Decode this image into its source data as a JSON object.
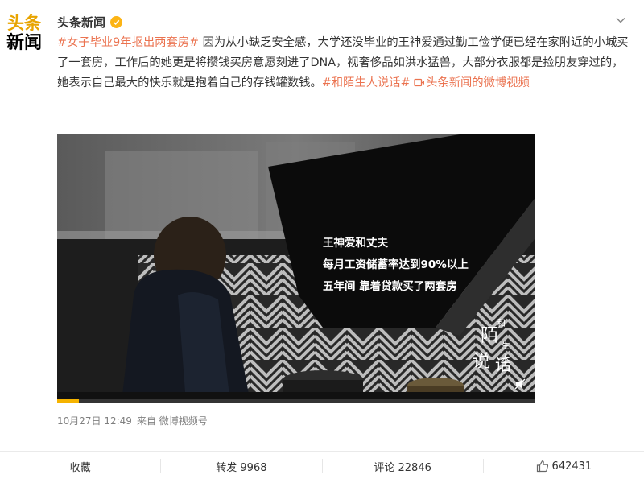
{
  "account": {
    "avatar_line1": "头条",
    "avatar_line2": "新闻",
    "name": "头条新闻"
  },
  "post": {
    "hashtag": "#女子毕业9年抠出两套房#",
    "body": " 因为从小缺乏安全感，大学还没毕业的王神爱通过勤工俭学便已经在家附近的小城买了一套房，工作后的她更是将攒钱买房意愿刻进了DNA，视奢侈品如洪水猛兽，大部分衣服都是捡朋友穿过的，她表示自己最大的快乐就是抱着自己的存钱罐数钱。",
    "hashtag2": "#和陌生人说话#",
    "video_link": "头条新闻的微博视频"
  },
  "video": {
    "caption_line1": "王神爱和丈夫",
    "caption_line2": "每月工资储蓄率达到90%以上",
    "caption_line3": "五年间 靠着贷款买了两套房",
    "watermark_chars": [
      "和",
      "陌",
      "生人",
      "说",
      "话"
    ],
    "progress_fraction": 0.045
  },
  "meta": {
    "time": "10月27日 12:49",
    "source": "来自 微博视频号"
  },
  "actions": {
    "favorite": "收藏",
    "repost": "转发 9968",
    "comment": "评论 22846",
    "like": "642431"
  },
  "colors": {
    "link": "#eb7350",
    "verified": "#fcb415",
    "progress": "#f5b300"
  }
}
